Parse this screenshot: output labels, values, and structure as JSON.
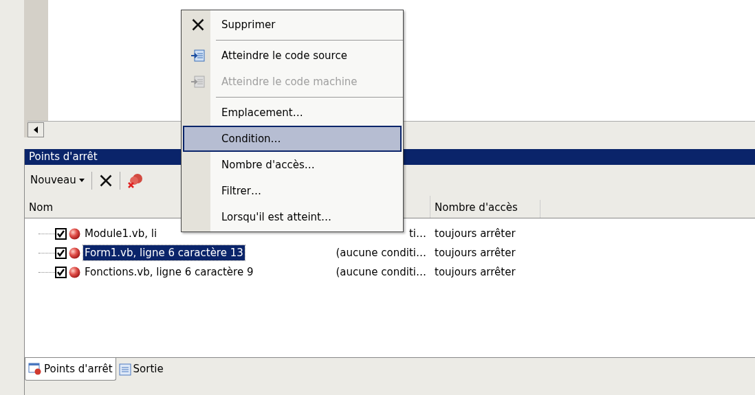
{
  "breakpoints_panel": {
    "title": "Points d'arrêt",
    "toolbar": {
      "new_button": "Nouveau"
    },
    "columns": [
      "Nom",
      "Nombre d'accès"
    ],
    "rows": [
      {
        "name": "Module1.vb, li",
        "condition": "ti…",
        "hit_count": "toujours arrêter",
        "checked": true,
        "selected": false
      },
      {
        "name": "Form1.vb, ligne 6 caractère 13",
        "condition": "(aucune conditi…",
        "hit_count": "toujours arrêter",
        "checked": true,
        "selected": true
      },
      {
        "name": "Fonctions.vb, ligne 6 caractère 9",
        "condition": "(aucune conditi…",
        "hit_count": "toujours arrêter",
        "checked": true,
        "selected": false
      }
    ]
  },
  "tabs": [
    {
      "label": "Points d'arrêt",
      "kind": "breakpoints",
      "selected": true
    },
    {
      "label": "Sortie",
      "kind": "output",
      "selected": false
    }
  ],
  "context_menu": {
    "items": [
      {
        "kind": "delete",
        "label": "Supprimer",
        "disabled": false,
        "selected": false
      },
      {
        "kind": "separator"
      },
      {
        "kind": "source",
        "label": "Atteindre le code source",
        "disabled": false,
        "selected": false
      },
      {
        "kind": "machine",
        "label": "Atteindre le code machine",
        "disabled": true,
        "selected": false
      },
      {
        "kind": "separator"
      },
      {
        "kind": "item",
        "label": "Emplacement…",
        "disabled": false,
        "selected": false
      },
      {
        "kind": "item",
        "label": "Condition…",
        "disabled": false,
        "selected": true
      },
      {
        "kind": "item",
        "label": "Nombre d'accès…",
        "disabled": false,
        "selected": false
      },
      {
        "kind": "item",
        "label": "Filtrer…",
        "disabled": false,
        "selected": false
      },
      {
        "kind": "item",
        "label": "Lorsqu'il est atteint…",
        "disabled": false,
        "selected": false
      }
    ]
  }
}
